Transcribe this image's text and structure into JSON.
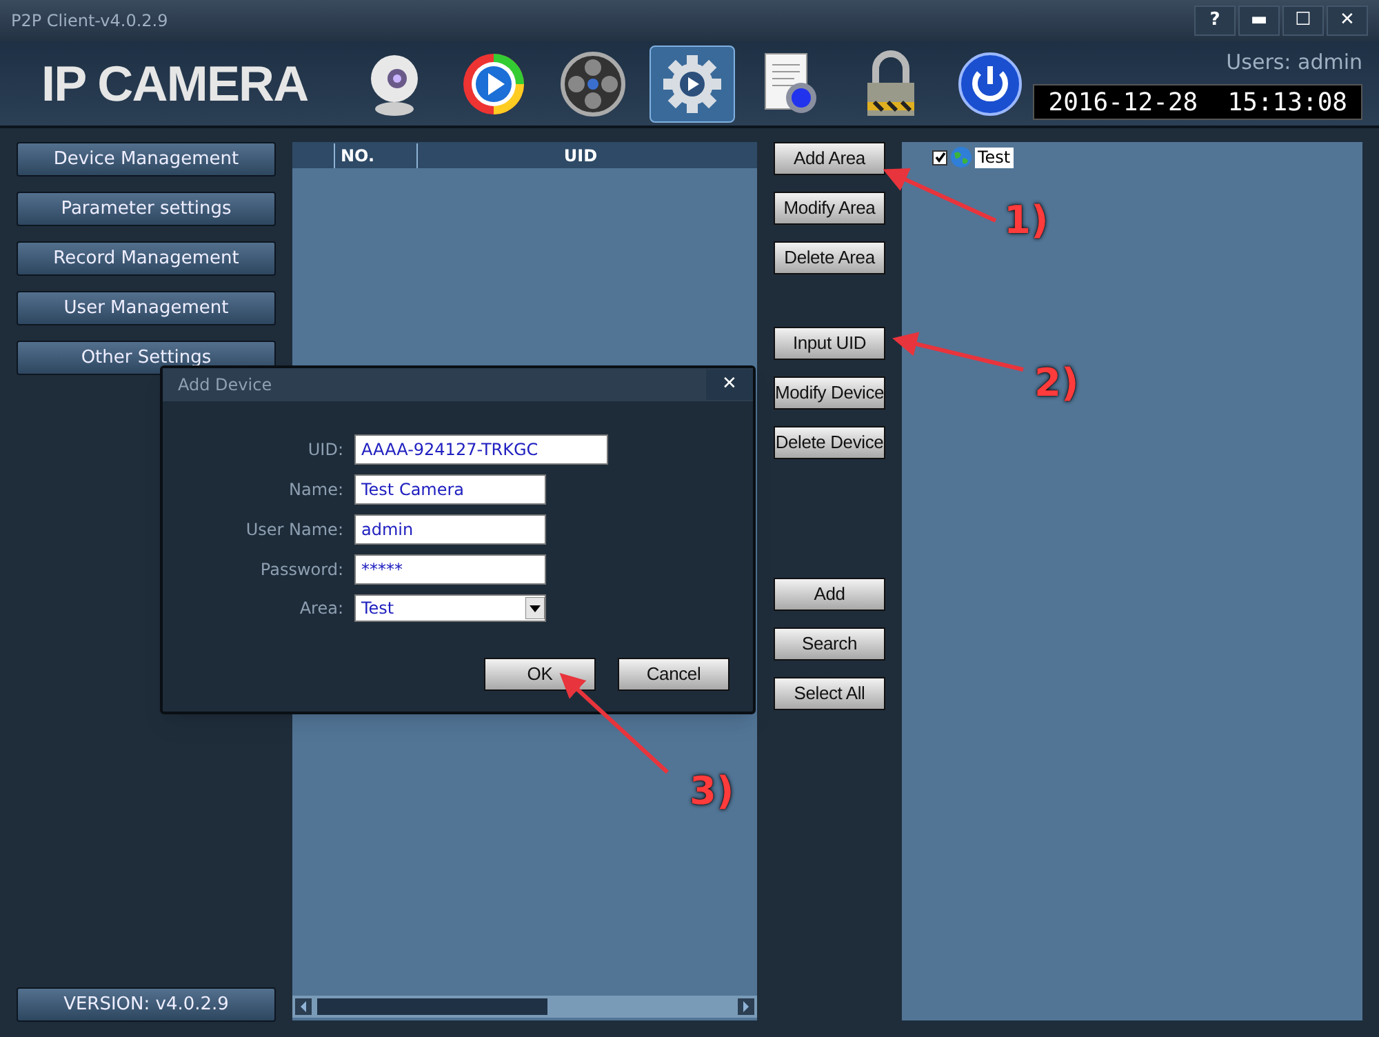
{
  "window": {
    "title": "P2P Client-v4.0.2.9",
    "controls": [
      "?",
      "▬",
      "☐",
      "✕"
    ]
  },
  "header": {
    "logo": "IP CAMERA",
    "user": "Users: admin",
    "datetime": "2016-12-28  15:13:08",
    "toolbar": [
      {
        "kind": "webcam",
        "selected": false
      },
      {
        "kind": "play",
        "selected": false
      },
      {
        "kind": "reel",
        "selected": false
      },
      {
        "kind": "gear",
        "selected": true
      },
      {
        "kind": "document",
        "selected": false
      },
      {
        "kind": "lock",
        "selected": false
      },
      {
        "kind": "power",
        "selected": false
      }
    ]
  },
  "sidebar": {
    "items": [
      "Device Management",
      "Parameter settings",
      "Record Management",
      "User Management",
      "Other Settings"
    ],
    "version": "VERSION: v4.0.2.9"
  },
  "table": {
    "columns": [
      "NO.",
      "UID"
    ]
  },
  "action_groups": [
    [
      "Add Area",
      "Modify Area",
      "Delete Area"
    ],
    [
      "Input UID",
      "Modify Device",
      "Delete Device"
    ],
    [
      "Add",
      "Search",
      "Select All"
    ]
  ],
  "tree": {
    "items": [
      {
        "label": "Test",
        "checked": true,
        "selected": true
      }
    ]
  },
  "dialog": {
    "title": "Add Device",
    "close": "✕",
    "fields": [
      {
        "label": "UID:",
        "value": "AAAA-924127-TRKGC",
        "kind": "wide"
      },
      {
        "label": "Name:",
        "value": "Test Camera",
        "kind": "text"
      },
      {
        "label": "User Name:",
        "value": "admin",
        "kind": "text"
      },
      {
        "label": "Password:",
        "value": "*****",
        "kind": "text"
      },
      {
        "label": "Area:",
        "value": "Test",
        "kind": "select"
      }
    ],
    "buttons": [
      "OK",
      "Cancel"
    ]
  },
  "annotations": [
    {
      "label": "1)"
    },
    {
      "label": "2)"
    },
    {
      "label": "3)"
    }
  ]
}
